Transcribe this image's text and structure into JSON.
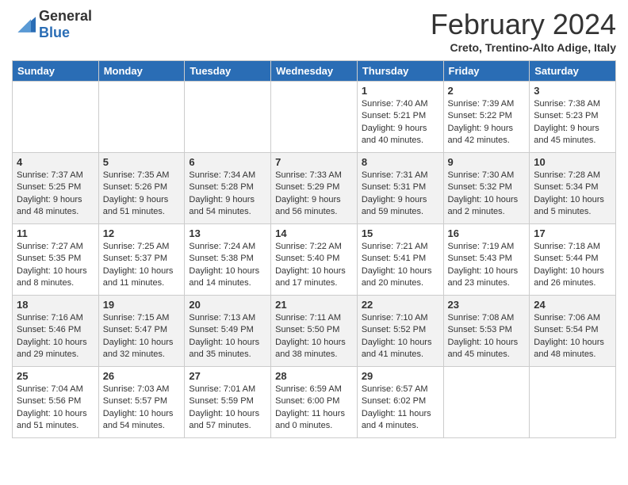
{
  "header": {
    "logo_general": "General",
    "logo_blue": "Blue",
    "month_title": "February 2024",
    "location": "Creto, Trentino-Alto Adige, Italy"
  },
  "weekdays": [
    "Sunday",
    "Monday",
    "Tuesday",
    "Wednesday",
    "Thursday",
    "Friday",
    "Saturday"
  ],
  "weeks": [
    [
      {
        "day": "",
        "info": ""
      },
      {
        "day": "",
        "info": ""
      },
      {
        "day": "",
        "info": ""
      },
      {
        "day": "",
        "info": ""
      },
      {
        "day": "1",
        "info": "Sunrise: 7:40 AM\nSunset: 5:21 PM\nDaylight: 9 hours\nand 40 minutes."
      },
      {
        "day": "2",
        "info": "Sunrise: 7:39 AM\nSunset: 5:22 PM\nDaylight: 9 hours\nand 42 minutes."
      },
      {
        "day": "3",
        "info": "Sunrise: 7:38 AM\nSunset: 5:23 PM\nDaylight: 9 hours\nand 45 minutes."
      }
    ],
    [
      {
        "day": "4",
        "info": "Sunrise: 7:37 AM\nSunset: 5:25 PM\nDaylight: 9 hours\nand 48 minutes."
      },
      {
        "day": "5",
        "info": "Sunrise: 7:35 AM\nSunset: 5:26 PM\nDaylight: 9 hours\nand 51 minutes."
      },
      {
        "day": "6",
        "info": "Sunrise: 7:34 AM\nSunset: 5:28 PM\nDaylight: 9 hours\nand 54 minutes."
      },
      {
        "day": "7",
        "info": "Sunrise: 7:33 AM\nSunset: 5:29 PM\nDaylight: 9 hours\nand 56 minutes."
      },
      {
        "day": "8",
        "info": "Sunrise: 7:31 AM\nSunset: 5:31 PM\nDaylight: 9 hours\nand 59 minutes."
      },
      {
        "day": "9",
        "info": "Sunrise: 7:30 AM\nSunset: 5:32 PM\nDaylight: 10 hours\nand 2 minutes."
      },
      {
        "day": "10",
        "info": "Sunrise: 7:28 AM\nSunset: 5:34 PM\nDaylight: 10 hours\nand 5 minutes."
      }
    ],
    [
      {
        "day": "11",
        "info": "Sunrise: 7:27 AM\nSunset: 5:35 PM\nDaylight: 10 hours\nand 8 minutes."
      },
      {
        "day": "12",
        "info": "Sunrise: 7:25 AM\nSunset: 5:37 PM\nDaylight: 10 hours\nand 11 minutes."
      },
      {
        "day": "13",
        "info": "Sunrise: 7:24 AM\nSunset: 5:38 PM\nDaylight: 10 hours\nand 14 minutes."
      },
      {
        "day": "14",
        "info": "Sunrise: 7:22 AM\nSunset: 5:40 PM\nDaylight: 10 hours\nand 17 minutes."
      },
      {
        "day": "15",
        "info": "Sunrise: 7:21 AM\nSunset: 5:41 PM\nDaylight: 10 hours\nand 20 minutes."
      },
      {
        "day": "16",
        "info": "Sunrise: 7:19 AM\nSunset: 5:43 PM\nDaylight: 10 hours\nand 23 minutes."
      },
      {
        "day": "17",
        "info": "Sunrise: 7:18 AM\nSunset: 5:44 PM\nDaylight: 10 hours\nand 26 minutes."
      }
    ],
    [
      {
        "day": "18",
        "info": "Sunrise: 7:16 AM\nSunset: 5:46 PM\nDaylight: 10 hours\nand 29 minutes."
      },
      {
        "day": "19",
        "info": "Sunrise: 7:15 AM\nSunset: 5:47 PM\nDaylight: 10 hours\nand 32 minutes."
      },
      {
        "day": "20",
        "info": "Sunrise: 7:13 AM\nSunset: 5:49 PM\nDaylight: 10 hours\nand 35 minutes."
      },
      {
        "day": "21",
        "info": "Sunrise: 7:11 AM\nSunset: 5:50 PM\nDaylight: 10 hours\nand 38 minutes."
      },
      {
        "day": "22",
        "info": "Sunrise: 7:10 AM\nSunset: 5:52 PM\nDaylight: 10 hours\nand 41 minutes."
      },
      {
        "day": "23",
        "info": "Sunrise: 7:08 AM\nSunset: 5:53 PM\nDaylight: 10 hours\nand 45 minutes."
      },
      {
        "day": "24",
        "info": "Sunrise: 7:06 AM\nSunset: 5:54 PM\nDaylight: 10 hours\nand 48 minutes."
      }
    ],
    [
      {
        "day": "25",
        "info": "Sunrise: 7:04 AM\nSunset: 5:56 PM\nDaylight: 10 hours\nand 51 minutes."
      },
      {
        "day": "26",
        "info": "Sunrise: 7:03 AM\nSunset: 5:57 PM\nDaylight: 10 hours\nand 54 minutes."
      },
      {
        "day": "27",
        "info": "Sunrise: 7:01 AM\nSunset: 5:59 PM\nDaylight: 10 hours\nand 57 minutes."
      },
      {
        "day": "28",
        "info": "Sunrise: 6:59 AM\nSunset: 6:00 PM\nDaylight: 11 hours\nand 0 minutes."
      },
      {
        "day": "29",
        "info": "Sunrise: 6:57 AM\nSunset: 6:02 PM\nDaylight: 11 hours\nand 4 minutes."
      },
      {
        "day": "",
        "info": ""
      },
      {
        "day": "",
        "info": ""
      }
    ]
  ]
}
